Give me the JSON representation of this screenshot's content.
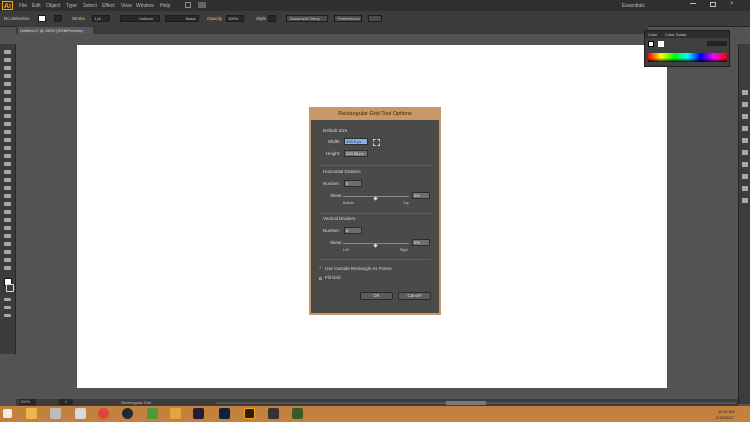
{
  "app": {
    "logo": "Ai",
    "workspace": "Essentials"
  },
  "menu": [
    "File",
    "Edit",
    "Object",
    "Type",
    "Select",
    "Effect",
    "View",
    "Window",
    "Help"
  ],
  "control": {
    "selection": "No Selection",
    "stroke_label": "Stroke",
    "stroke_value": "1 pt",
    "brush": "Uniform",
    "style_label": "Basic",
    "opacity_label": "Opacity",
    "opacity_value": "100%",
    "style2": "Style",
    "doc_setup": "Document Setup",
    "prefs": "Preferences"
  },
  "document_tab": "Untitled-1* @ 150% (RGB/Preview)",
  "color_panel": {
    "tab1": "Color",
    "tab2": "Color Guide"
  },
  "status": {
    "zoom": "150%",
    "page": "1",
    "tool": "Rectangular Grid"
  },
  "dialog": {
    "title": "Rectangular Grid Tool Options",
    "default_size": "Default Size",
    "width_label": "Width:",
    "width_value": "200.5 px",
    "height_label": "Height:",
    "height_value": "200.35 px",
    "horizontal_dividers": "Horizontal Dividers",
    "h_number_label": "Number:",
    "h_number_value": "5",
    "h_skew_label": "Skew:",
    "h_skew_value": "0%",
    "h_skew_left": "Bottom",
    "h_skew_right": "Top",
    "vertical_dividers": "Vertical Dividers",
    "v_number_label": "Number:",
    "v_number_value": "5",
    "v_skew_label": "Skew:",
    "v_skew_value": "0%",
    "v_skew_left": "Left",
    "v_skew_right": "Right",
    "use_outside_rect": "Use Outside Rectangle As Frame",
    "fill_grid": "Fill Grid",
    "ok": "OK",
    "cancel": "Cancel"
  },
  "taskbar": {
    "time": "11:31 AM",
    "date": "2/10/2017"
  }
}
